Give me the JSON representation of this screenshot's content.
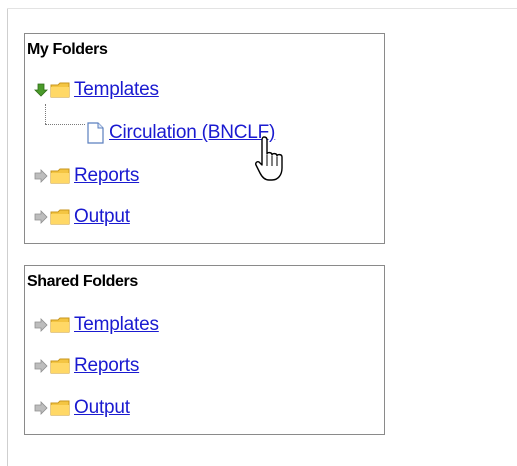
{
  "my_folders": {
    "title": "My Folders",
    "items": [
      {
        "label": "Templates",
        "expanded": true
      },
      {
        "label": "Circulation (BNCLF)",
        "type": "document"
      },
      {
        "label": "Reports",
        "expanded": false
      },
      {
        "label": "Output",
        "expanded": false
      }
    ]
  },
  "shared_folders": {
    "title": "Shared Folders",
    "items": [
      {
        "label": "Templates",
        "expanded": false
      },
      {
        "label": "Reports",
        "expanded": false
      },
      {
        "label": "Output",
        "expanded": false
      }
    ]
  },
  "colors": {
    "link": "#1a1ad0",
    "expanded_arrow": "#4a9a2a",
    "collapsed_arrow": "#b8b8b8",
    "folder": "#f4c542",
    "panel_border": "#8a8a8a"
  }
}
